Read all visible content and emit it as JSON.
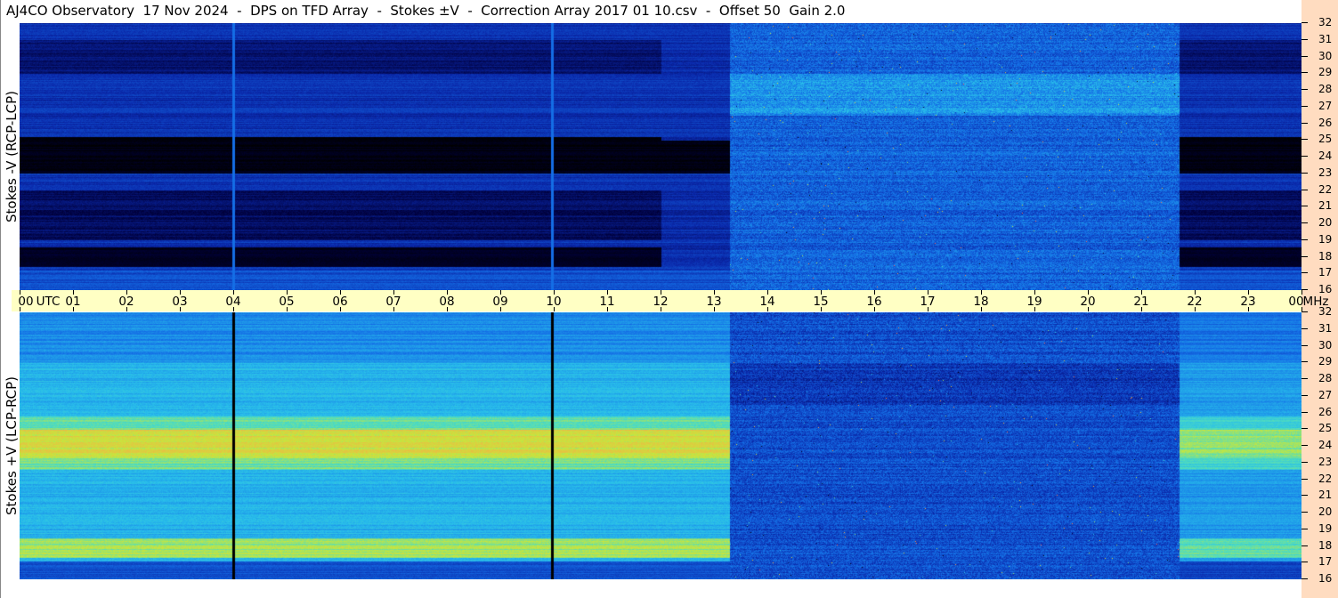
{
  "title": "AJ4CO Observatory  17 Nov 2024  -  DPS on TFD Array  -  Stokes ±V  -  Correction Array 2017 01 10.csv  -  Offset 50  Gain 2.0",
  "chart_data": [
    {
      "type": "heatmap",
      "ylabel": "Stokes -V (RCP-LCP)",
      "ylim": [
        16,
        32
      ],
      "xlim": [
        0,
        24
      ],
      "grid": false
    },
    {
      "type": "heatmap",
      "ylabel": "Stokes +V (LCP-RCP)",
      "ylim": [
        16,
        32
      ],
      "xlim": [
        0,
        24
      ],
      "grid": false
    }
  ],
  "x_axis": {
    "unit_left": "UTC",
    "unit_right": "MHz",
    "ticks": [
      "00",
      "01",
      "02",
      "03",
      "04",
      "05",
      "06",
      "07",
      "08",
      "09",
      "10",
      "11",
      "12",
      "13",
      "14",
      "15",
      "16",
      "17",
      "18",
      "19",
      "20",
      "21",
      "22",
      "23",
      "00"
    ]
  },
  "y_ticks": [
    "16",
    "17",
    "18",
    "19",
    "20",
    "21",
    "22",
    "23",
    "24",
    "25",
    "26",
    "27",
    "28",
    "29",
    "30",
    "31",
    "32"
  ],
  "colors": {
    "axis_band": "#ffffc4",
    "right_strip": "#ffdcc0"
  }
}
